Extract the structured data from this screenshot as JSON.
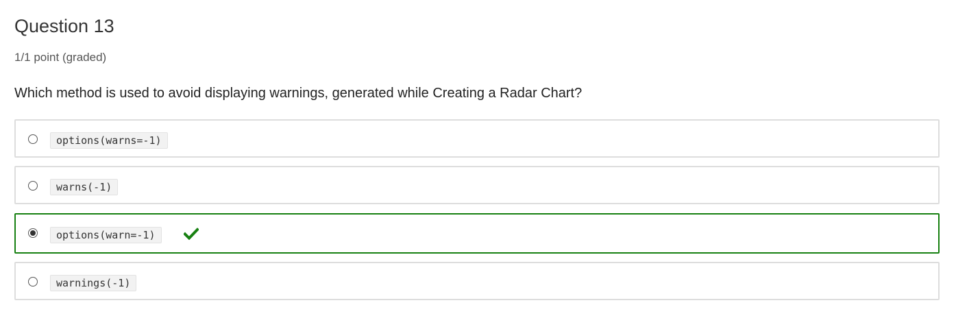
{
  "question": {
    "title": "Question 13",
    "points": "1/1 point (graded)",
    "prompt": "Which method is used to avoid displaying warnings, generated while Creating a Radar Chart?"
  },
  "choices": [
    {
      "code": "options(warns=-1)",
      "selected": false,
      "status": "none"
    },
    {
      "code": "warns(-1)",
      "selected": false,
      "status": "none"
    },
    {
      "code": "options(warn=-1)",
      "selected": true,
      "status": "correct",
      "status_icon": "checkmark-icon"
    },
    {
      "code": "warnings(-1)",
      "selected": false,
      "status": "none"
    }
  ],
  "colors": {
    "correct": "#178011",
    "border": "#dddddd",
    "code_bg": "#f2f2f2"
  }
}
